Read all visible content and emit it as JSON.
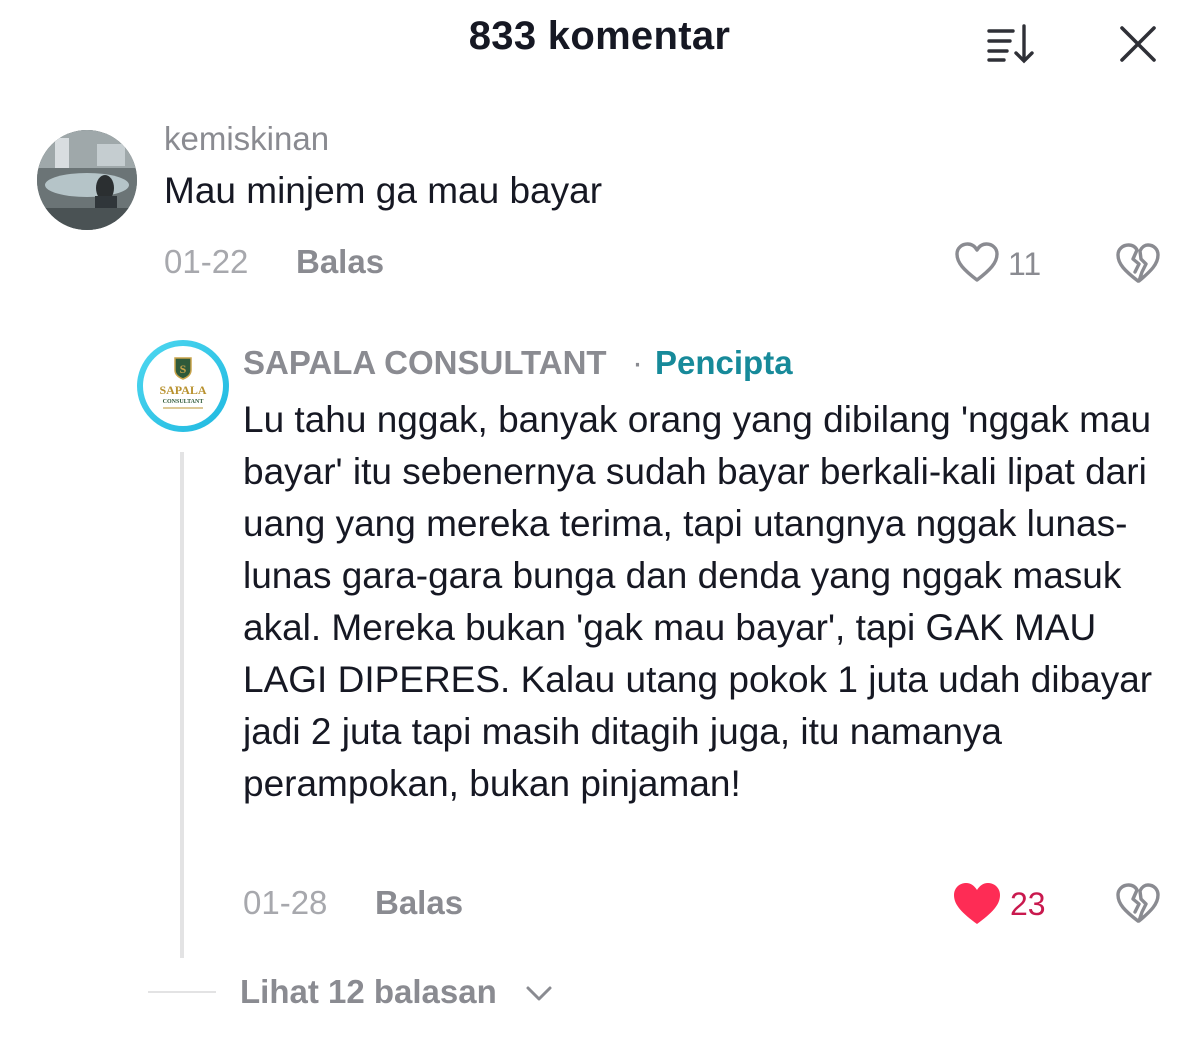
{
  "header": {
    "title": "833 komentar",
    "sort_icon": "sort-icon",
    "close_icon": "close-icon"
  },
  "comments": [
    {
      "username": "kemiskinan",
      "text": "Mau minjem ga mau bayar",
      "date": "01-22",
      "reply_label": "Balas",
      "likes": "11",
      "liked": false
    },
    {
      "username": "SAPALA CONSULTANT",
      "separator": "·",
      "badge": "Pencipta",
      "avatar_text": "SAPALA",
      "avatar_subtext": "CONSULTANT",
      "text": "Lu tahu nggak, banyak orang yang dibilang 'nggak mau bayar' itu sebenernya sudah bayar berkali-kali lipat dari uang yang mereka terima, tapi utangnya nggak lunas-lunas gara-gara bunga dan denda yang nggak masuk akal. Mereka bukan 'gak mau bayar', tapi GAK MAU LAGI DIPERES. Kalau utang pokok 1 juta udah dibayar jadi 2 juta tapi masih ditagih juga, itu namanya perampokan, bukan pinjaman!",
      "date": "01-28",
      "reply_label": "Balas",
      "likes": "23",
      "liked": true
    }
  ],
  "view_replies": "Lihat 12 balasan",
  "colors": {
    "text": "#161823",
    "secondary": "#8a8b91",
    "creator_badge": "#178a9a",
    "liked": "#fe2c55"
  }
}
